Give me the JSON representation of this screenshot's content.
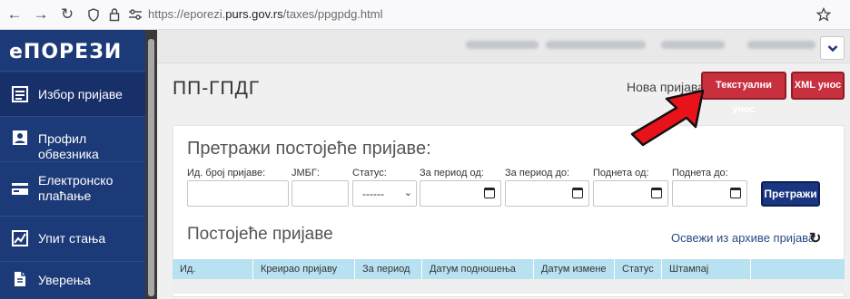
{
  "browser": {
    "url_prefix": "https://eporezi.",
    "url_domain": "purs.gov.rs",
    "url_path": "/taxes/ppgpdg.html"
  },
  "sidebar": {
    "brand": "еПОРЕЗИ",
    "items": [
      {
        "label": "Избор пријаве",
        "icon": "list-icon"
      },
      {
        "label": "Профил обвезника",
        "icon": "profile-icon"
      },
      {
        "label": "Електронско плаћање",
        "icon": "card-icon"
      },
      {
        "label": "Упит стања",
        "icon": "chart-icon"
      },
      {
        "label": "Уверења",
        "icon": "document-icon"
      }
    ]
  },
  "page": {
    "title": "ПП-ГПДГ",
    "new_label": "Нова пријава:",
    "btn_text_entry": "Текстуални унос",
    "btn_xml_entry": "XML унос"
  },
  "search": {
    "title": "Претражи постојеће пријаве:",
    "fields": [
      {
        "label": "Ид. број пријаве:"
      },
      {
        "label": "ЈМБГ:"
      },
      {
        "label": "Статус:",
        "value": "------"
      },
      {
        "label": "За период од:"
      },
      {
        "label": "За период до:"
      },
      {
        "label": "Поднета од:"
      },
      {
        "label": "Поднета до:"
      }
    ],
    "button": "Претражи"
  },
  "existing": {
    "title": "Постојеће пријаве",
    "refresh_label": "Освежи из архиве пријава",
    "refresh_icon": "↻",
    "columns": [
      "Ид.",
      "Креирао пријаву",
      "За период",
      "Датум подношења",
      "Датум измене",
      "Статус",
      "Штампај"
    ]
  },
  "colors": {
    "sidebar": "#1c3a78",
    "red_button": "#c9303e",
    "primary_button": "#1a3680",
    "table_header": "#b8e2f2",
    "arrow": "#e8121b"
  }
}
